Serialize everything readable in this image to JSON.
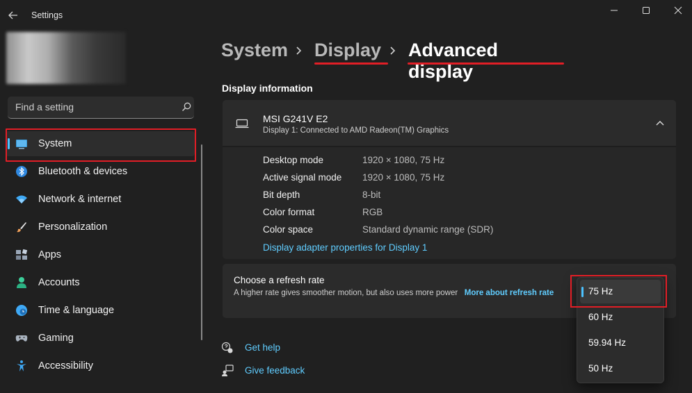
{
  "window": {
    "title": "Settings",
    "minimize_label": "—",
    "maximize_label": "□",
    "close_label": "✕"
  },
  "search": {
    "placeholder": "Find a setting"
  },
  "sidebar": {
    "items": [
      {
        "label": "System",
        "icon": "monitor-icon",
        "selected": true
      },
      {
        "label": "Bluetooth & devices",
        "icon": "bluetooth-icon"
      },
      {
        "label": "Network & internet",
        "icon": "wifi-icon"
      },
      {
        "label": "Personalization",
        "icon": "brush-icon"
      },
      {
        "label": "Apps",
        "icon": "apps-icon"
      },
      {
        "label": "Accounts",
        "icon": "person-icon"
      },
      {
        "label": "Time & language",
        "icon": "clock-globe-icon"
      },
      {
        "label": "Gaming",
        "icon": "gamepad-icon"
      },
      {
        "label": "Accessibility",
        "icon": "accessibility-icon"
      }
    ]
  },
  "breadcrumb": {
    "system": "System",
    "display": "Display",
    "current": "Advanced display"
  },
  "display_info": {
    "section_title": "Display information",
    "monitor_name": "MSI G241V E2",
    "monitor_subtitle": "Display 1: Connected to AMD Radeon(TM) Graphics",
    "rows": [
      {
        "label": "Desktop mode",
        "value": "1920 × 1080, 75 Hz"
      },
      {
        "label": "Active signal mode",
        "value": "1920 × 1080, 75 Hz"
      },
      {
        "label": "Bit depth",
        "value": "8-bit"
      },
      {
        "label": "Color format",
        "value": "RGB"
      },
      {
        "label": "Color space",
        "value": "Standard dynamic range (SDR)"
      }
    ],
    "adapter_link": "Display adapter properties for Display 1"
  },
  "refresh_rate": {
    "title": "Choose a refresh rate",
    "description": "A higher rate gives smoother motion, but also uses more power",
    "link": "More about refresh rate",
    "options": [
      "75 Hz",
      "60 Hz",
      "59.94 Hz",
      "50 Hz"
    ],
    "selected": "75 Hz"
  },
  "footer": {
    "help": "Get help",
    "feedback": "Give feedback"
  },
  "colors": {
    "accent": "#4cc2ff",
    "link": "#60cdff",
    "highlight_red": "#e21e26",
    "background": "#202020"
  }
}
